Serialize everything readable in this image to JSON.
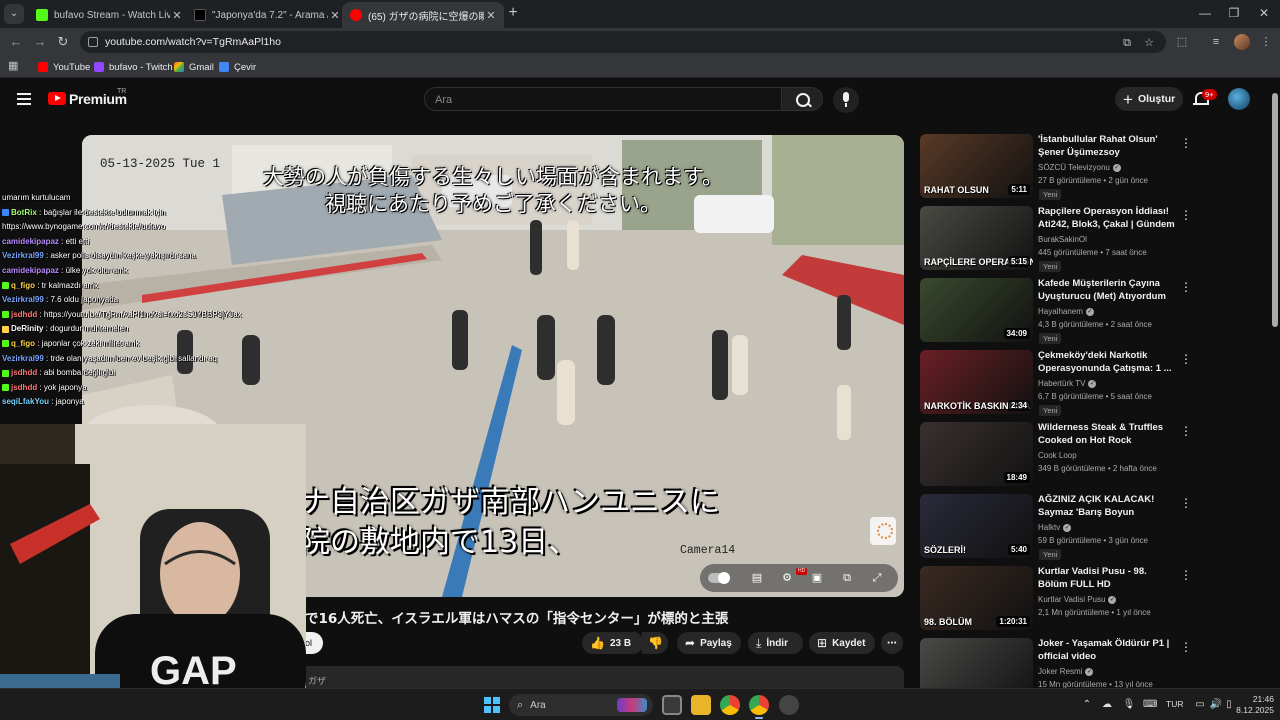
{
  "browser": {
    "tabs": [
      {
        "title": "bufavo Stream - Watch Live on",
        "favicon_color": "#53fc18"
      },
      {
        "title": "\"Japonya'da 7.2\" - Arama / X",
        "favicon_color": "#000000"
      },
      {
        "title": "(65) ガザの病院に空爆の瞬間",
        "favicon_color": "#ff0000"
      }
    ],
    "url": "youtube.com/watch?v=TgRmAaPl1ho",
    "bookmarks": [
      {
        "label": "YouTube",
        "color": "#ff0000"
      },
      {
        "label": "bufavo - Twitch",
        "color": "#9146ff"
      },
      {
        "label": "Gmail",
        "color": "#ea4335"
      },
      {
        "label": "Çevir",
        "color": "#4285f4"
      }
    ]
  },
  "youtube": {
    "brand": "Premium",
    "region": "TR",
    "search_placeholder": "Ara",
    "create_label": "Oluştur",
    "notification_count": "9+",
    "video": {
      "warning_line1": "大勢の人が負傷する生々しい場面が含まれます。",
      "warning_line2": "視聴にあたり予めご了承ください。",
      "subtitle_line1": "ナ自治区ガザ南部ハンユニスに",
      "subtitle_line2": "院の敷地内で13日、",
      "cctv_timestamp": "05-13-2025  Tue 1",
      "camera_label": "Camera14"
    },
    "title_visible": "で16人死亡、イスラエル軍はハマスの「指令センター」が標的と主張",
    "subscribe_partial": "ol",
    "actions": {
      "likes": "23 B",
      "share": "Paylaş",
      "download": "İndir",
      "save": "Kaydet"
    },
    "description_partial": "ガザ"
  },
  "recommendations": [
    {
      "title": "'İstanbullular Rahat Olsun' Şener Üşümezsoy Marmara'daki O ...",
      "channel": "SÖZCÜ Televizyonu",
      "verified": true,
      "meta": "27 B görüntüleme • 2 gün önce",
      "badge": "Yeni",
      "duration": "5:11",
      "thumb_caption": "RAHAT OLSUN",
      "thumb_color": "#5a3a26"
    },
    {
      "title": "Rapçilere Operasyon İddiası! Ati242, Blok3, Çakal | Gündem",
      "channel": "BurakSakinOl",
      "verified": false,
      "meta": "445 görüntüleme • 7 saat önce",
      "badge": "Yeni",
      "duration": "5:15",
      "thumb_caption": "RAPÇİLERE OPERASYON",
      "thumb_color": "#4a4a44"
    },
    {
      "title": "Kafede Müşterilerin Çayına Uyuşturucu (Met) Atıyordum",
      "channel": "Hayalhanem",
      "verified": true,
      "meta": "4,3 B görüntüleme • 2 saat önce",
      "badge": "Yeni",
      "duration": "34:09",
      "thumb_caption": "",
      "thumb_color": "#3a4a2e"
    },
    {
      "title": "Çekmeköy'deki Narkotik Operasyonunda Çatışma: 1 ...",
      "channel": "Habertürk TV",
      "verified": true,
      "meta": "6,7 B görüntüleme • 5 saat önce",
      "badge": "Yeni",
      "duration": "2:34",
      "thumb_caption": "NARKOTİK BASKININDA",
      "thumb_color": "#6a1f24"
    },
    {
      "title": "Wilderness Steak & Truffles Cooked on Hot Rock",
      "channel": "Cook Loop",
      "verified": false,
      "meta": "349 B görüntüleme • 2 hafta önce",
      "badge": "",
      "duration": "18:49",
      "thumb_caption": "",
      "thumb_color": "#3a3030"
    },
    {
      "title": "AĞZINIZ AÇIK KALACAK! Saymaz 'Barış Boyun Çetesi'ni...",
      "channel": "Halktv",
      "verified": true,
      "meta": "59 B görüntüleme • 3 gün önce",
      "badge": "Yeni",
      "duration": "5:40",
      "thumb_caption": "SÖZLERİ!",
      "thumb_color": "#2a2a3a"
    },
    {
      "title": "Kurtlar Vadisi Pusu - 98. Bölüm FULL HD",
      "channel": "Kurtlar Vadisi Pusu",
      "verified": true,
      "meta": "2,1 Mn görüntüleme • 1 yıl önce",
      "badge": "",
      "duration": "1:20:31",
      "thumb_caption": "98. BÖLÜM",
      "thumb_color": "#3a2a22"
    },
    {
      "title": "Joker - Yaşamak Öldürür P1 | official video",
      "channel": "Joker Resmi",
      "verified": true,
      "meta": "15 Mn görüntüleme • 13 yıl önce",
      "badge": "",
      "duration": "4:55",
      "thumb_caption": "YAŞAMAK ÖLDÜRÜR",
      "thumb_color": "#4a4a48"
    }
  ],
  "chat": [
    {
      "user": "",
      "text": "umarım kurtulucam",
      "color": "#ffffff",
      "badge": ""
    },
    {
      "user": "BotRix",
      "text": " : bağışlar ile destekte bulunmak için",
      "color": "#a0ff70",
      "badge": "#3a86ff"
    },
    {
      "user": "",
      "text": "https://www.bynogame.com/tr/destekle/bufavo",
      "color": "#ffffff",
      "badge": ""
    },
    {
      "user": "camidekipapaz",
      "text": " : etti etti",
      "color": "#b98cff",
      "badge": ""
    },
    {
      "user": "Vezirkral99",
      "text": " : asker polis olsaydın keşke yakışırdı sana",
      "color": "#7aa8ff",
      "badge": ""
    },
    {
      "user": "camidekipapaz",
      "text": " : ülke yok olur amk",
      "color": "#b98cff",
      "badge": ""
    },
    {
      "user": "q_figo",
      "text": " : tr kalmazdı amk",
      "color": "#ffd24a",
      "badge": "#53fc18"
    },
    {
      "user": "Vezirkral99",
      "text": " : 7.6 oldu japonyada",
      "color": "#7aa8ff",
      "badge": ""
    },
    {
      "user": "jsdhdd",
      "text": " : https://youtu.be/TgRmAaPl1ho?si=fxo2sSJYBBP3jYJax",
      "color": "#ff7a7a",
      "badge": "#53fc18"
    },
    {
      "user": "DeRinity",
      "text": " : dogurdur muhtemelen",
      "color": "#ffffff",
      "badge": "#ffd24a"
    },
    {
      "user": "q_figo",
      "text": " : japonlar çok zeki millet amk",
      "color": "#ffd24a",
      "badge": "#53fc18"
    },
    {
      "user": "Vezirkral99",
      "text": " : trde olanıyaşadım ben ev beşik gibi sallandı aq",
      "color": "#7aa8ff",
      "badge": ""
    },
    {
      "user": "jsdhdd",
      "text": " : abi bomba değil gibi",
      "color": "#ff7a7a",
      "badge": "#53fc18"
    },
    {
      "user": "jsdhdd",
      "text": " : yok japonya",
      "color": "#ff7a7a",
      "badge": "#53fc18"
    },
    {
      "user": "seqiLfakYou",
      "text": " : japonya",
      "color": "#7ad4ff",
      "badge": ""
    }
  ],
  "taskbar": {
    "search_label": "Ara",
    "language": "TUR",
    "time": "21:46",
    "date": "8.12.2025"
  }
}
